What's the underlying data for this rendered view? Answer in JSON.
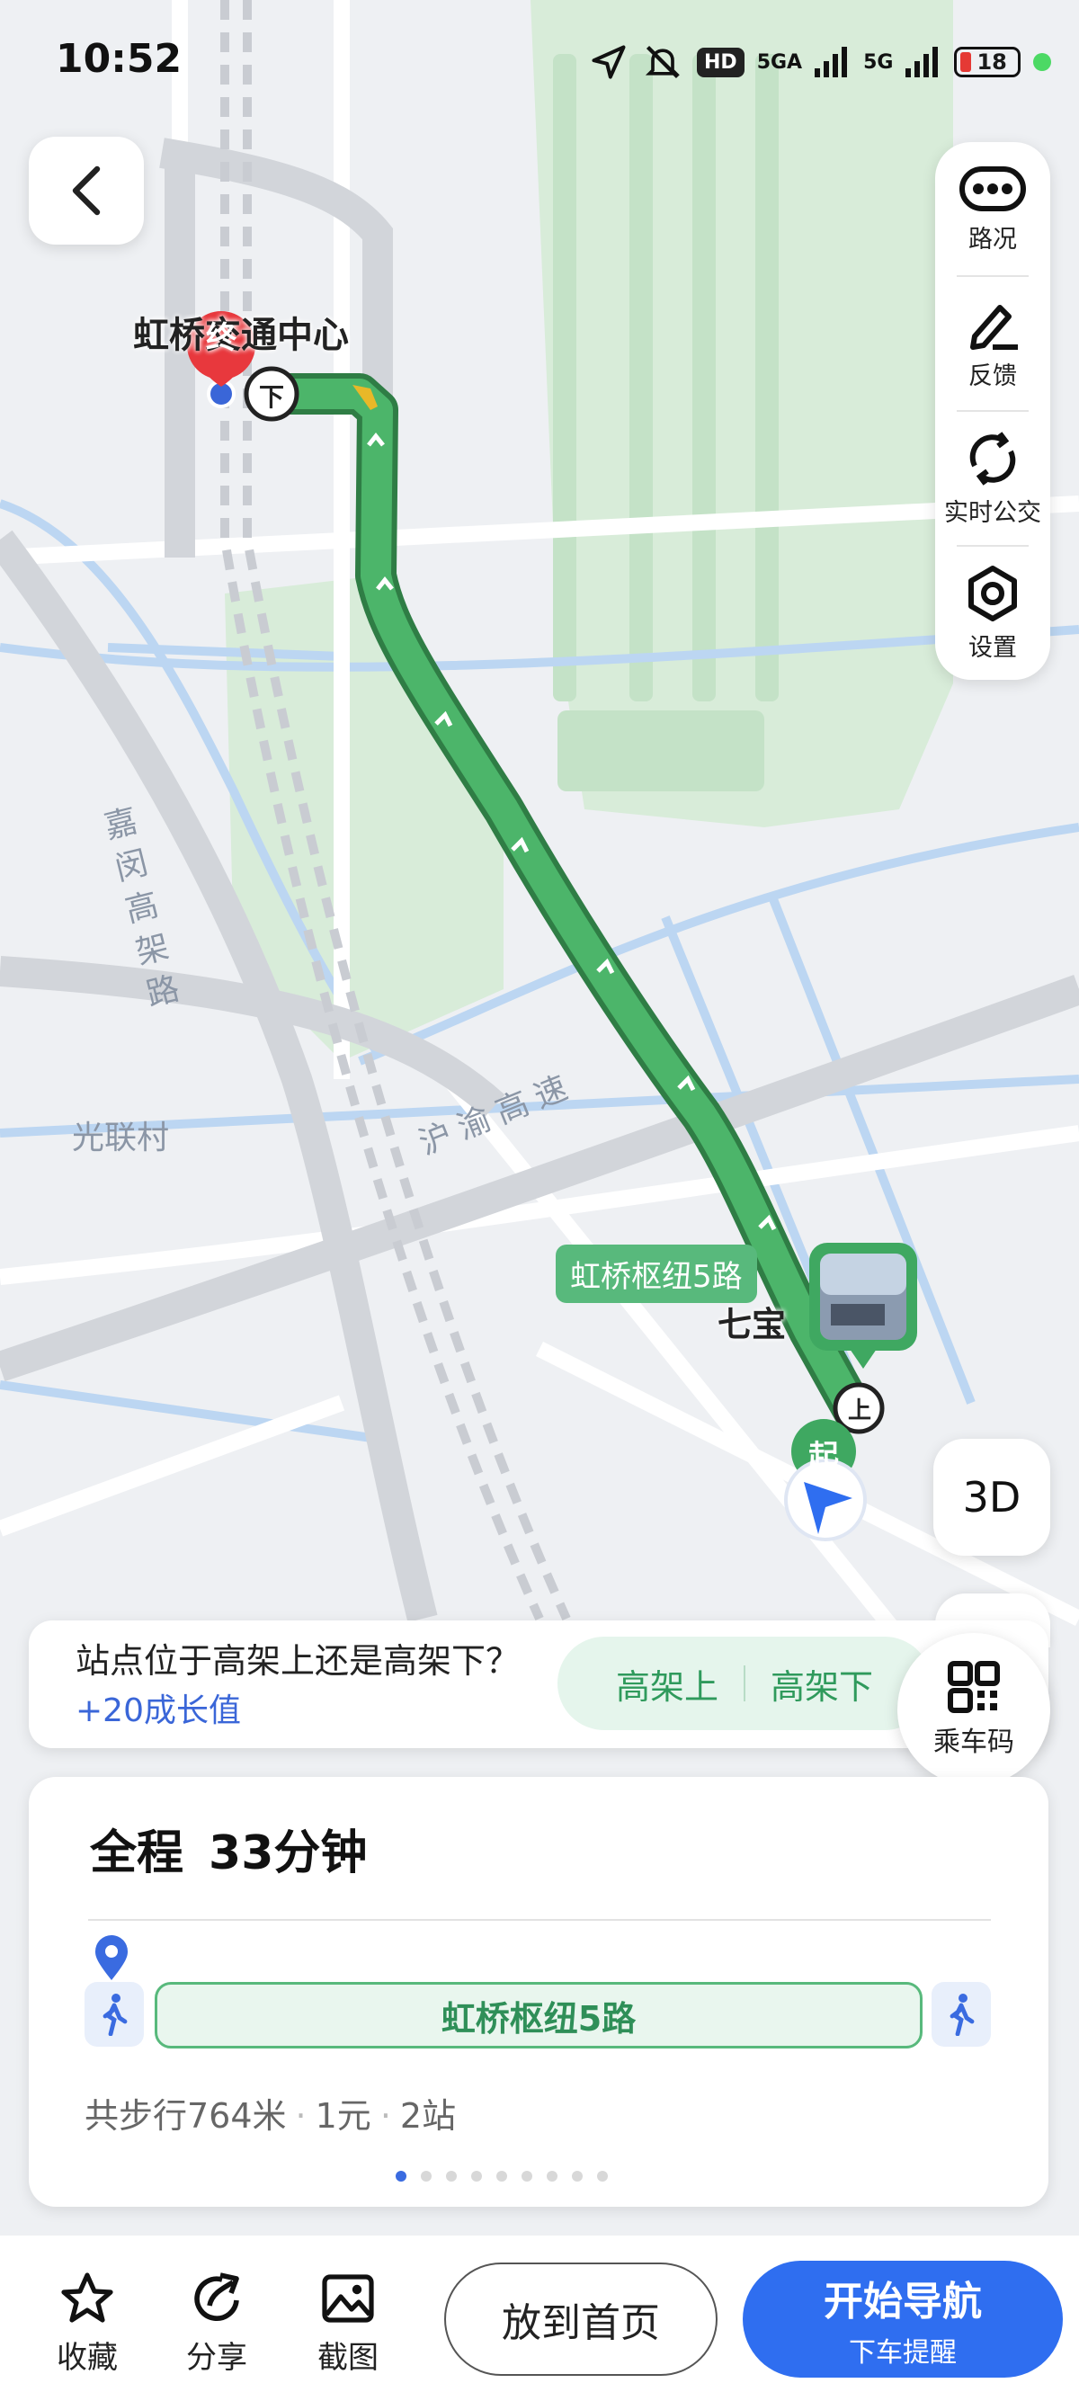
{
  "status_bar": {
    "time": "10:52",
    "hd_badge": "HD",
    "net1": "5GA",
    "net2": "5G",
    "battery": "18"
  },
  "map": {
    "destination_label": "虹桥交通中心",
    "end_marker": "终",
    "start_marker": "起",
    "alight_marker": "下",
    "board_marker": "上",
    "road_jiamin": "嘉闵高架路",
    "road_huyu": "沪渝高速",
    "place_guanglian": "光联村",
    "place_qibao": "七宝",
    "route_tag": "虹桥枢纽5路"
  },
  "right_tools": [
    {
      "label": "路况",
      "icon": "traffic-icon"
    },
    {
      "label": "反馈",
      "icon": "feedback-pen-icon"
    },
    {
      "label": "实时公交",
      "icon": "realtime-bus-icon"
    },
    {
      "label": "设置",
      "icon": "settings-hex-icon"
    }
  ],
  "btn_3d": "3D",
  "question": {
    "text": "站点位于高架上还是高架下？",
    "bonus": "+20成长值",
    "option_above": "高架上",
    "option_below": "高架下"
  },
  "qr": {
    "label": "乘车码"
  },
  "route_card": {
    "title_prefix": "全程",
    "duration": "33分钟",
    "bus_line": "虹桥枢纽5路",
    "walk": "共步行764米",
    "fare": "1元",
    "stops": "2站",
    "page_count": 9,
    "active_page": 1
  },
  "bottom": {
    "favorite": "收藏",
    "share": "分享",
    "screenshot": "截图",
    "home": "放到首页",
    "navigate": "开始导航",
    "navigate_sub": "下车提醒"
  },
  "colors": {
    "route": "#3fa861",
    "accent": "#2f6ef0",
    "end_pin": "#e8383d"
  }
}
